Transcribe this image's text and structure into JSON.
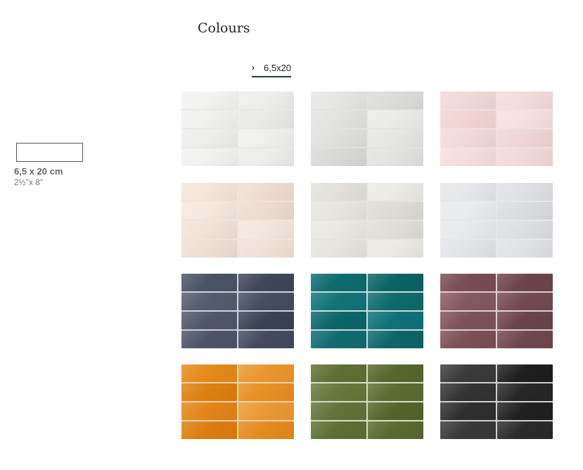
{
  "header": {
    "title": "Colours"
  },
  "size_tabs": [
    {
      "label": "6,5x20",
      "active": true
    }
  ],
  "size_option": {
    "metric": "6,5 x 20 cm",
    "imperial": "2½\"x 8\""
  },
  "colour_swatches": [
    {
      "name": "white",
      "grout": "#e8e8e8",
      "colors": [
        "#f3f3f2",
        "#eeeeed",
        "#f1f1f0",
        "#e9e9e7",
        "#eeeeec",
        "#f0f0ee",
        "#f2f2f1",
        "#ededeb"
      ]
    },
    {
      "name": "light-grey",
      "grout": "#e2e2e1",
      "colors": [
        "#e6e6e5",
        "#dcdcdb",
        "#e3e3e2",
        "#ebebea",
        "#e0e0df",
        "#e6e6e5",
        "#d9d9d8",
        "#e2e2e1"
      ]
    },
    {
      "name": "pink",
      "grout": "#f3dfdd",
      "colors": [
        "#f1d9d7",
        "#f4dcdb",
        "#f0d5d3",
        "#f6e1df",
        "#f3dad8",
        "#f0d6d4",
        "#f5dedc",
        "#f2d9d7"
      ]
    },
    {
      "name": "beige",
      "grout": "#efe3da",
      "colors": [
        "#f3e5da",
        "#efddd2",
        "#f5e8de",
        "#ecdcd1",
        "#f1e2d7",
        "#f3e6dc",
        "#eedfd4",
        "#f0e1d6"
      ]
    },
    {
      "name": "ivory",
      "grout": "#e4e3de",
      "colors": [
        "#e3e1da",
        "#ebeae4",
        "#e6e5df",
        "#dddcd5",
        "#e9e8e2",
        "#dfded7",
        "#e5e4de",
        "#eae9e3"
      ]
    },
    {
      "name": "pale-grey",
      "grout": "#e6e7ea",
      "colors": [
        "#e6e7ea",
        "#e0e1e5",
        "#eaebee",
        "#dcdde1",
        "#e8e9ec",
        "#dedfe3",
        "#e3e4e8",
        "#e1e2e6"
      ]
    },
    {
      "name": "navy",
      "grout": "#d0d2d8",
      "colors": [
        "#4b5466",
        "#3e4657",
        "#545c6d",
        "#454d5f",
        "#4f5769",
        "#3a4253",
        "#4c5466",
        "#424a5c"
      ]
    },
    {
      "name": "teal",
      "grout": "#c9dcdc",
      "colors": [
        "#0e6b6e",
        "#0a6366",
        "#127478",
        "#0d6a6c",
        "#0b6568",
        "#10707a",
        "#0f6c70",
        "#0c6669"
      ]
    },
    {
      "name": "plum",
      "grout": "#dccfd0",
      "colors": [
        "#7a4c54",
        "#6e444c",
        "#845a60",
        "#744a52",
        "#7e5158",
        "#6a434b",
        "#7b4f56",
        "#70474f"
      ]
    },
    {
      "name": "orange",
      "grout": "#f3d0a8",
      "colors": [
        "#e58a1b",
        "#ea9630",
        "#de7f12",
        "#e78e22",
        "#e2851a",
        "#eb9936",
        "#dd7d10",
        "#e48a1e"
      ]
    },
    {
      "name": "green",
      "grout": "#d6dcc6",
      "colors": [
        "#5f7035",
        "#56672d",
        "#66783c",
        "#5b6c31",
        "#61733a",
        "#53652b",
        "#5d6f34",
        "#586a30"
      ]
    },
    {
      "name": "black",
      "grout": "#cfcfcf",
      "colors": [
        "#3a3a3a",
        "#1e1e1e",
        "#333333",
        "#262626",
        "#2e2e2e",
        "#202020",
        "#383838",
        "#2a2a2a"
      ]
    }
  ]
}
